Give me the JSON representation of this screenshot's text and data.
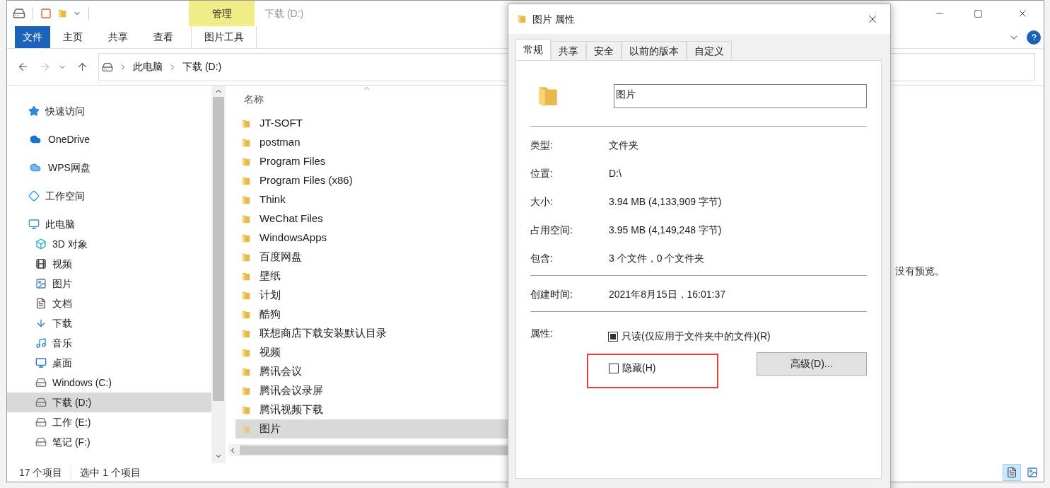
{
  "explorer": {
    "title": "下载 (D:)",
    "context_tab": "管理",
    "ribbon_tabs": [
      {
        "label": "文件",
        "kind": "file"
      },
      {
        "label": "主页",
        "kind": "tab"
      },
      {
        "label": "共享",
        "kind": "tab"
      },
      {
        "label": "查看",
        "kind": "tab"
      },
      {
        "label": "图片工具",
        "kind": "contextual"
      }
    ],
    "breadcrumbs": [
      "此电脑",
      "下载 (D:)"
    ],
    "sidebar": {
      "items": [
        {
          "label": "快速访问",
          "selected": false
        },
        {
          "label": "OneDrive",
          "selected": false
        },
        {
          "label": "WPS网盘",
          "selected": false
        },
        {
          "label": "工作空间",
          "selected": false
        },
        {
          "label": "此电脑",
          "selected": false,
          "children": [
            {
              "label": "3D 对象",
              "selected": false
            },
            {
              "label": "视频",
              "selected": false
            },
            {
              "label": "图片",
              "selected": false
            },
            {
              "label": "文档",
              "selected": false
            },
            {
              "label": "下载",
              "selected": false
            },
            {
              "label": "音乐",
              "selected": false
            },
            {
              "label": "桌面",
              "selected": false
            },
            {
              "label": "Windows (C:)",
              "selected": false
            },
            {
              "label": "下载 (D:)",
              "selected": true
            },
            {
              "label": "工作 (E:)",
              "selected": false
            },
            {
              "label": "笔记 (F:)",
              "selected": false
            }
          ]
        }
      ]
    },
    "file_list": {
      "column": "名称",
      "items": [
        {
          "name": "JT-SOFT",
          "selected": false
        },
        {
          "name": "postman",
          "selected": false
        },
        {
          "name": "Program Files",
          "selected": false
        },
        {
          "name": "Program Files (x86)",
          "selected": false
        },
        {
          "name": "Think",
          "selected": false
        },
        {
          "name": "WeChat Files",
          "selected": false
        },
        {
          "name": "WindowsApps",
          "selected": false
        },
        {
          "name": "百度网盘",
          "selected": false
        },
        {
          "name": "壁纸",
          "selected": false
        },
        {
          "name": "计划",
          "selected": false
        },
        {
          "name": "酷狗",
          "selected": false
        },
        {
          "name": "联想商店下载安装默认目录",
          "selected": false
        },
        {
          "name": "视频",
          "selected": false
        },
        {
          "name": "腾讯会议",
          "selected": false
        },
        {
          "name": "腾讯会议录屏",
          "selected": false
        },
        {
          "name": "腾讯视频下载",
          "selected": false
        },
        {
          "name": "图片",
          "selected": true
        }
      ]
    },
    "preview": "没有预览。",
    "status_bar": [
      "17 个项目",
      "选中 1 个项目"
    ],
    "view_buttons": [
      {
        "selected": true
      },
      {
        "selected": false
      }
    ]
  },
  "dialog": {
    "title": "图片 属性",
    "tabs": [
      {
        "label": "常规",
        "selected": true
      },
      {
        "label": "共享",
        "selected": false
      },
      {
        "label": "安全",
        "selected": false
      },
      {
        "label": "以前的版本",
        "selected": false
      },
      {
        "label": "自定义",
        "selected": false
      }
    ],
    "name": "图片",
    "groups": [
      [
        {
          "label": "类型:",
          "value": "文件夹"
        },
        {
          "label": "位置:",
          "value": "D:\\"
        },
        {
          "label": "大小:",
          "value": "3.94 MB (4,133,909 字节)"
        },
        {
          "label": "占用空间:",
          "value": "3.95 MB (4,149,248 字节)"
        },
        {
          "label": "包含:",
          "value": "3 个文件，0 个文件夹"
        }
      ],
      [
        {
          "label": "创建时间:",
          "value": "2021年8月15日，16:01:37"
        }
      ]
    ],
    "attributes_label": "属性:",
    "attributes": [
      {
        "label": "只读(仅应用于文件夹中的文件)(R)",
        "indeterminate": true,
        "highlighted": false
      },
      {
        "label": "隐藏(H)",
        "checked": false,
        "highlighted": true
      }
    ],
    "advanced_button": "高级(D)..."
  }
}
